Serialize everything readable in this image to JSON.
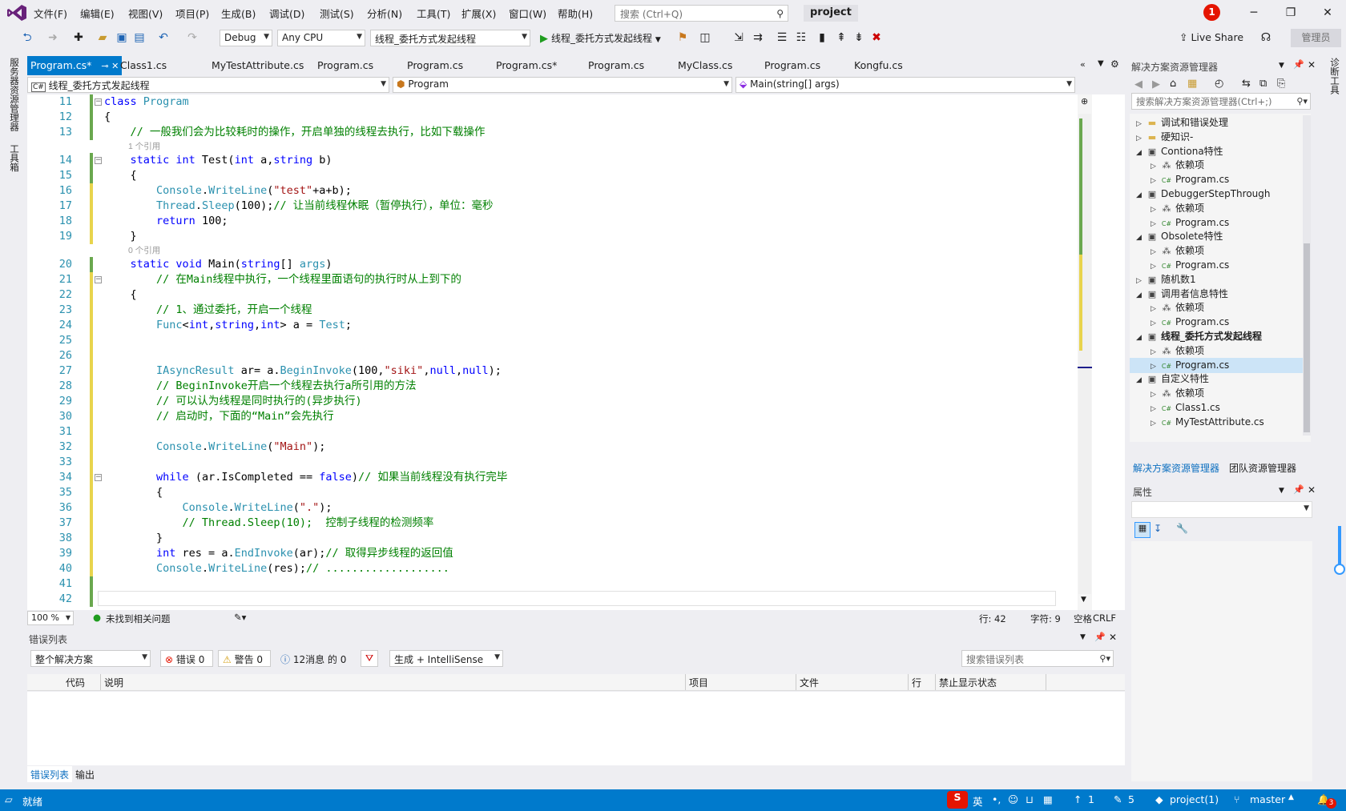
{
  "menu": [
    "文件(F)",
    "编辑(E)",
    "视图(V)",
    "项目(P)",
    "生成(B)",
    "调试(D)",
    "测试(S)",
    "分析(N)",
    "工具(T)",
    "扩展(X)",
    "窗口(W)",
    "帮助(H)"
  ],
  "search_placeholder": "搜索 (Ctrl+Q)",
  "project_name": "project",
  "notification_count": "1",
  "toolbar": {
    "config": "Debug",
    "platform": "Any CPU",
    "startup": "线程_委托方式发起线程",
    "run_label": "线程_委托方式发起线程",
    "live_share": "Live Share",
    "admin": "管理员"
  },
  "left_tabs": [
    "服务器资源管理器",
    "工具箱"
  ],
  "right_tabs": [
    "诊断工具"
  ],
  "tabs": [
    "Program.cs*",
    "Class1.cs",
    "MyTestAttribute.cs",
    "Program.cs",
    "Program.cs",
    "Program.cs*",
    "Program.cs",
    "MyClass.cs",
    "Program.cs",
    "Kongfu.cs"
  ],
  "nav": {
    "project": "线程_委托方式发起线程",
    "class": "Program",
    "member": "Main(string[] args)"
  },
  "code_lines": [
    {
      "n": "11",
      "parts": [
        [
          "kw",
          "class "
        ],
        [
          "ty",
          "Program"
        ]
      ]
    },
    {
      "n": "12",
      "parts": [
        [
          "nm",
          "{"
        ]
      ]
    },
    {
      "n": "13",
      "parts": [
        [
          "nm",
          "    "
        ],
        [
          "cm",
          "// 一般我们会为比较耗时的操作，开启单独的线程去执行，比如下载操作"
        ]
      ]
    },
    {
      "n": "14",
      "lens": "1 个引用",
      "parts": [
        [
          "nm",
          "    "
        ],
        [
          "kw",
          "static int "
        ],
        [
          "nm",
          "Test("
        ],
        [
          "kw",
          "int "
        ],
        [
          "nm",
          "a,"
        ],
        [
          "kw",
          "string "
        ],
        [
          "nm",
          "b)"
        ]
      ]
    },
    {
      "n": "15",
      "parts": [
        [
          "nm",
          "    {"
        ]
      ]
    },
    {
      "n": "16",
      "parts": [
        [
          "nm",
          "        "
        ],
        [
          "ty",
          "Console"
        ],
        [
          "nm",
          "."
        ],
        [
          "ty",
          "WriteLine"
        ],
        [
          "nm",
          "("
        ],
        [
          "st",
          "\"test\""
        ],
        [
          "nm",
          "+a+b);"
        ]
      ]
    },
    {
      "n": "17",
      "parts": [
        [
          "nm",
          "        "
        ],
        [
          "ty",
          "Thread"
        ],
        [
          "nm",
          "."
        ],
        [
          "ty",
          "Sleep"
        ],
        [
          "nm",
          "(100);"
        ],
        [
          "cm",
          "// 让当前线程休眠（暂停执行），单位：毫秒"
        ]
      ]
    },
    {
      "n": "18",
      "parts": [
        [
          "nm",
          "        "
        ],
        [
          "kw",
          "return "
        ],
        [
          "nm",
          "100;"
        ]
      ]
    },
    {
      "n": "19",
      "parts": [
        [
          "nm",
          "    }"
        ]
      ]
    },
    {
      "n": "20",
      "lens": "0 个引用",
      "parts": [
        [
          "nm",
          "    "
        ],
        [
          "kw",
          "static void "
        ],
        [
          "nm",
          "Main("
        ],
        [
          "kw",
          "string"
        ],
        [
          "nm",
          "[] "
        ],
        [
          "ty",
          "args"
        ],
        [
          "nm",
          ")"
        ]
      ]
    },
    {
      "n": "21",
      "parts": [
        [
          "nm",
          "        "
        ],
        [
          "cm",
          "// 在Main线程中执行，一个线程里面语句的执行时从上到下的"
        ]
      ]
    },
    {
      "n": "22",
      "parts": [
        [
          "nm",
          "    {"
        ]
      ]
    },
    {
      "n": "23",
      "parts": [
        [
          "nm",
          "        "
        ],
        [
          "cm",
          "// 1、通过委托，开启一个线程"
        ]
      ]
    },
    {
      "n": "24",
      "parts": [
        [
          "nm",
          "        "
        ],
        [
          "ty",
          "Func"
        ],
        [
          "nm",
          "<"
        ],
        [
          "kw",
          "int"
        ],
        [
          "nm",
          ","
        ],
        [
          "kw",
          "string"
        ],
        [
          "nm",
          ","
        ],
        [
          "kw",
          "int"
        ],
        [
          "nm",
          "> a = "
        ],
        [
          "ty",
          "Test"
        ],
        [
          "nm",
          ";"
        ]
      ]
    },
    {
      "n": "25",
      "parts": [
        [
          "nm",
          ""
        ]
      ]
    },
    {
      "n": "26",
      "parts": [
        [
          "nm",
          ""
        ]
      ]
    },
    {
      "n": "27",
      "parts": [
        [
          "nm",
          "        "
        ],
        [
          "ty",
          "IAsyncResult "
        ],
        [
          "nm",
          "ar= a."
        ],
        [
          "ty",
          "BeginInvoke"
        ],
        [
          "nm",
          "(100,"
        ],
        [
          "st",
          "\"siki\""
        ],
        [
          "nm",
          ","
        ],
        [
          "kw",
          "null"
        ],
        [
          "nm",
          ","
        ],
        [
          "kw",
          "null"
        ],
        [
          "nm",
          ");"
        ]
      ]
    },
    {
      "n": "28",
      "parts": [
        [
          "nm",
          "        "
        ],
        [
          "cm",
          "// BeginInvoke开启一个线程去执行a所引用的方法"
        ]
      ]
    },
    {
      "n": "29",
      "parts": [
        [
          "nm",
          "        "
        ],
        [
          "cm",
          "// 可以认为线程是同时执行的(异步执行)"
        ]
      ]
    },
    {
      "n": "30",
      "parts": [
        [
          "nm",
          "        "
        ],
        [
          "cm",
          "// 启动时，下面的“Main”会先执行"
        ]
      ]
    },
    {
      "n": "31",
      "parts": [
        [
          "nm",
          ""
        ]
      ]
    },
    {
      "n": "32",
      "parts": [
        [
          "nm",
          "        "
        ],
        [
          "ty",
          "Console"
        ],
        [
          "nm",
          "."
        ],
        [
          "ty",
          "WriteLine"
        ],
        [
          "nm",
          "("
        ],
        [
          "st",
          "\"Main\""
        ],
        [
          "nm",
          ");"
        ]
      ]
    },
    {
      "n": "33",
      "parts": [
        [
          "nm",
          ""
        ]
      ]
    },
    {
      "n": "34",
      "parts": [
        [
          "nm",
          "        "
        ],
        [
          "kw",
          "while "
        ],
        [
          "nm",
          "(ar.IsCompleted == "
        ],
        [
          "kw",
          "false"
        ],
        [
          "nm",
          ")"
        ],
        [
          "cm",
          "// 如果当前线程没有执行完毕"
        ]
      ]
    },
    {
      "n": "35",
      "parts": [
        [
          "nm",
          "        {"
        ]
      ]
    },
    {
      "n": "36",
      "parts": [
        [
          "nm",
          "            "
        ],
        [
          "ty",
          "Console"
        ],
        [
          "nm",
          "."
        ],
        [
          "ty",
          "WriteLine"
        ],
        [
          "nm",
          "("
        ],
        [
          "st",
          "\".\""
        ],
        [
          "nm",
          ");"
        ]
      ]
    },
    {
      "n": "37",
      "parts": [
        [
          "nm",
          "            "
        ],
        [
          "cm",
          "// Thread.Sleep(10);  控制子线程的检测频率"
        ]
      ]
    },
    {
      "n": "38",
      "parts": [
        [
          "nm",
          "        }"
        ]
      ]
    },
    {
      "n": "39",
      "parts": [
        [
          "nm",
          "        "
        ],
        [
          "kw",
          "int "
        ],
        [
          "nm",
          "res = a."
        ],
        [
          "ty",
          "EndInvoke"
        ],
        [
          "nm",
          "(ar);"
        ],
        [
          "cm",
          "// 取得异步线程的返回值"
        ]
      ]
    },
    {
      "n": "40",
      "parts": [
        [
          "nm",
          "        "
        ],
        [
          "ty",
          "Console"
        ],
        [
          "nm",
          "."
        ],
        [
          "ty",
          "WriteLine"
        ],
        [
          "nm",
          "(res);"
        ],
        [
          "cm",
          "// ..................."
        ]
      ]
    },
    {
      "n": "41",
      "parts": [
        [
          "nm",
          ""
        ]
      ]
    },
    {
      "n": "42",
      "parts": [
        [
          "nm",
          ""
        ]
      ]
    }
  ],
  "editor_status": {
    "zoom": "100 %",
    "issues": "未找到相关问题",
    "line": "行: 42",
    "char": "字符: 9",
    "space": "空格",
    "crlf": "CRLF"
  },
  "error_list": {
    "title": "错误列表",
    "scope": "整个解决方案",
    "errors": "错误 0",
    "warnings": "警告 0",
    "messages": "12消息 的 0",
    "build": "生成 + IntelliSense",
    "search_placeholder": "搜索错误列表",
    "columns": [
      "代码",
      "说明",
      "项目",
      "文件",
      "行",
      "禁止显示状态"
    ],
    "bottom_tabs": [
      "错误列表",
      "输出"
    ]
  },
  "solution": {
    "title": "解决方案资源管理器",
    "search_placeholder": "搜索解决方案资源管理器(Ctrl+;)",
    "items": [
      {
        "label": "调试和错误处理",
        "indent": 0,
        "arrow": "▷",
        "icon": "folder"
      },
      {
        "label": "硬知识-",
        "indent": 0,
        "arrow": "▷",
        "icon": "folder"
      },
      {
        "label": "Contiona特性",
        "indent": 0,
        "arrow": "◢",
        "icon": "proj"
      },
      {
        "label": "依赖项",
        "indent": 1,
        "arrow": "▷",
        "icon": "dep"
      },
      {
        "label": "Program.cs",
        "indent": 1,
        "arrow": "▷",
        "icon": "cs"
      },
      {
        "label": "DebuggerStepThrough",
        "indent": 0,
        "arrow": "◢",
        "icon": "proj"
      },
      {
        "label": "依赖项",
        "indent": 1,
        "arrow": "▷",
        "icon": "dep"
      },
      {
        "label": "Program.cs",
        "indent": 1,
        "arrow": "▷",
        "icon": "cs"
      },
      {
        "label": "Obsolete特性",
        "indent": 0,
        "arrow": "◢",
        "icon": "proj"
      },
      {
        "label": "依赖项",
        "indent": 1,
        "arrow": "▷",
        "icon": "dep"
      },
      {
        "label": "Program.cs",
        "indent": 1,
        "arrow": "▷",
        "icon": "cs"
      },
      {
        "label": "随机数1",
        "indent": 0,
        "arrow": "▷",
        "icon": "proj"
      },
      {
        "label": "调用者信息特性",
        "indent": 0,
        "arrow": "◢",
        "icon": "proj"
      },
      {
        "label": "依赖项",
        "indent": 1,
        "arrow": "▷",
        "icon": "dep"
      },
      {
        "label": "Program.cs",
        "indent": 1,
        "arrow": "▷",
        "icon": "cs"
      },
      {
        "label": "线程_委托方式发起线程",
        "indent": 0,
        "arrow": "◢",
        "icon": "proj",
        "bold": true
      },
      {
        "label": "依赖项",
        "indent": 1,
        "arrow": "▷",
        "icon": "dep"
      },
      {
        "label": "Program.cs",
        "indent": 1,
        "arrow": "▷",
        "icon": "cs",
        "selected": true
      },
      {
        "label": "自定义特性",
        "indent": 0,
        "arrow": "◢",
        "icon": "proj"
      },
      {
        "label": "依赖项",
        "indent": 1,
        "arrow": "▷",
        "icon": "dep"
      },
      {
        "label": "Class1.cs",
        "indent": 1,
        "arrow": "▷",
        "icon": "cs"
      },
      {
        "label": "MyTestAttribute.cs",
        "indent": 1,
        "arrow": "▷",
        "icon": "cs"
      }
    ],
    "bottom_tabs": [
      "解决方案资源管理器",
      "团队资源管理器"
    ]
  },
  "properties_title": "属性",
  "statusbar": {
    "ready": "就绪",
    "ime": "英",
    "up": "1",
    "edits": "5",
    "repo": "project(1)",
    "branch": "master",
    "bell": "3"
  }
}
